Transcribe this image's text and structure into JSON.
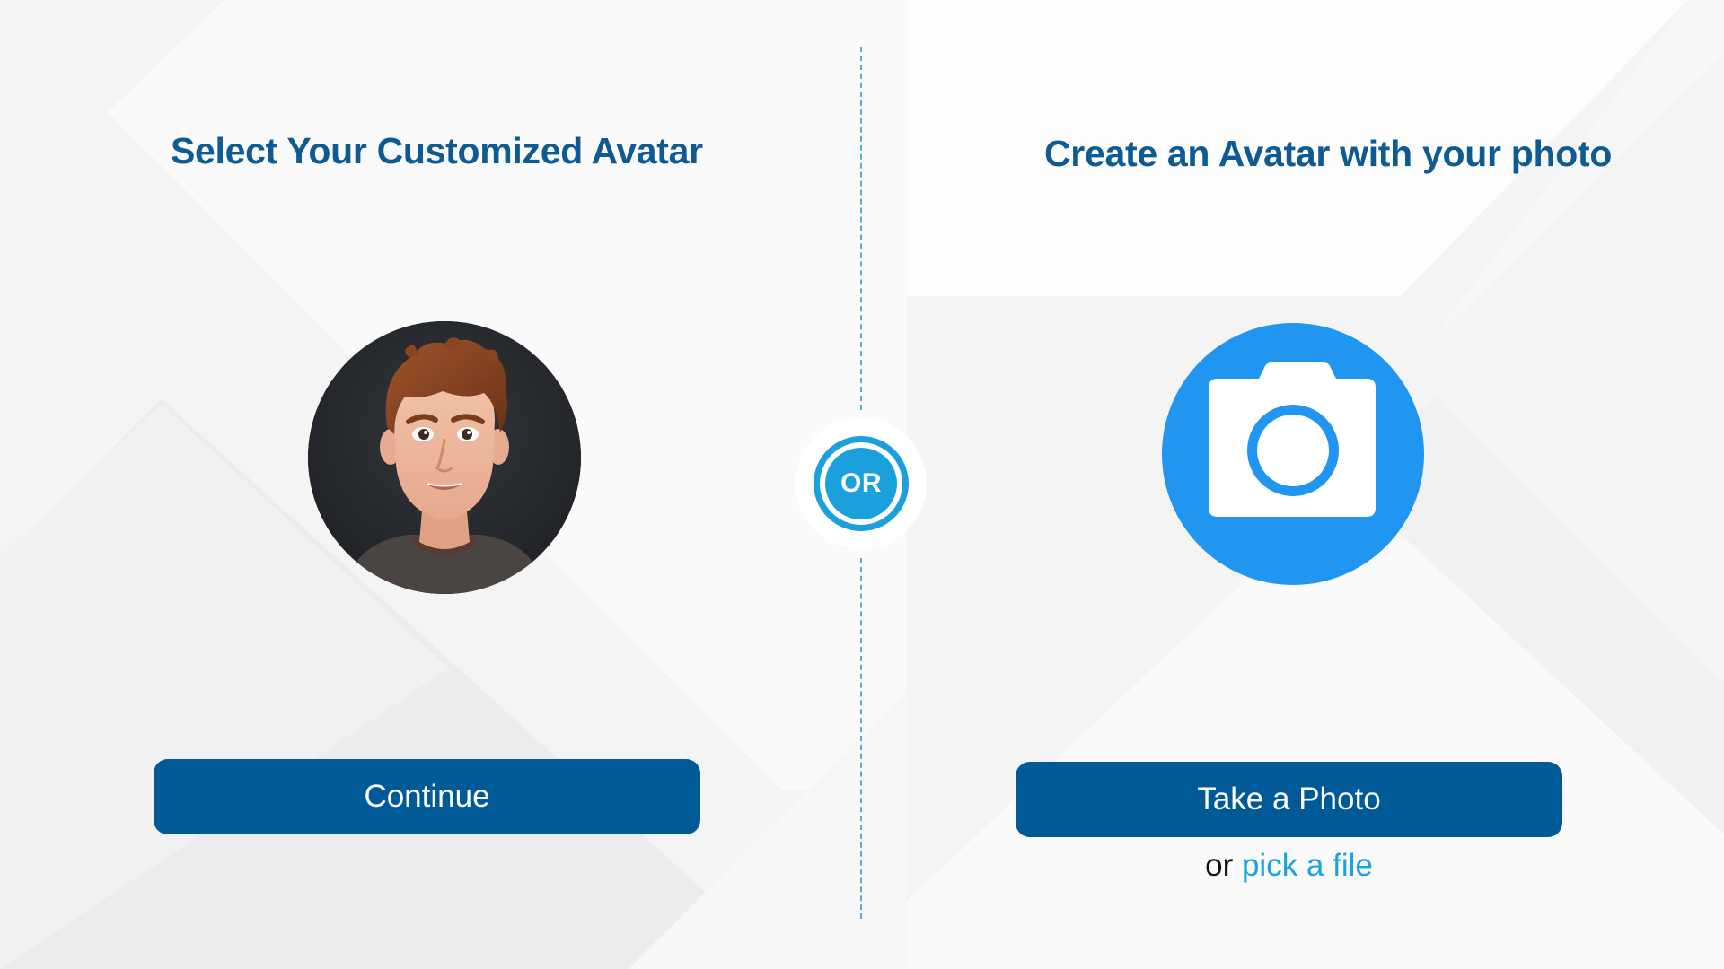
{
  "colors": {
    "heading": "#0e5a93",
    "button_bg": "#005a97",
    "accent": "#1aa0dd",
    "camera_bg": "#2196f0",
    "link": "#1aa3e0"
  },
  "left_panel": {
    "title": "Select Your Customized Avatar",
    "avatar_icon": "avatar-image",
    "button_label": "Continue"
  },
  "divider": {
    "or_label": "OR"
  },
  "right_panel": {
    "title": "Create an Avatar with your photo",
    "camera_icon": "camera-icon",
    "button_label": "Take a Photo",
    "alt_prefix": "or",
    "alt_link": "pick a file"
  }
}
